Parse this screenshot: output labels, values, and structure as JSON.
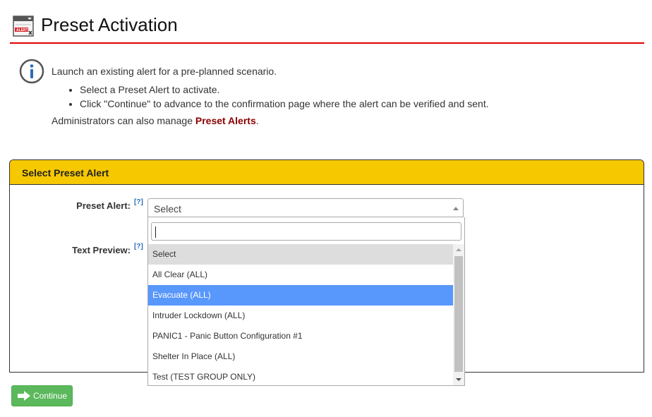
{
  "header": {
    "title": "Preset Activation",
    "icon_label": "ALERT"
  },
  "info": {
    "intro": "Launch an existing alert for a pre-planned scenario.",
    "bullets": [
      "Select a Preset Alert to activate.",
      "Click \"Continue\" to advance to the confirmation page where the alert can be verified and sent."
    ],
    "admin_prefix": "Administrators can also manage ",
    "admin_link": "Preset Alerts",
    "admin_suffix": "."
  },
  "panel": {
    "title": "Select Preset Alert",
    "preset_label": "Preset Alert:",
    "preview_label": "Text Preview:",
    "help_marker": "[?]"
  },
  "select": {
    "value": "Select",
    "search_value": "",
    "options": [
      "Select",
      "All Clear (ALL)",
      "Evacuate (ALL)",
      "Intruder Lockdown (ALL)",
      "PANIC1 - Panic Button Configuration #1",
      "Shelter In Place (ALL)",
      "Test (TEST GROUP ONLY)"
    ],
    "current_index": 0,
    "highlighted_index": 2
  },
  "actions": {
    "continue_label": "Continue"
  },
  "colors": {
    "accent_red": "#e00000",
    "panel_header": "#f6c800",
    "highlight": "#5897fb",
    "button_green": "#5cb85c",
    "link_red": "#8b0000"
  }
}
